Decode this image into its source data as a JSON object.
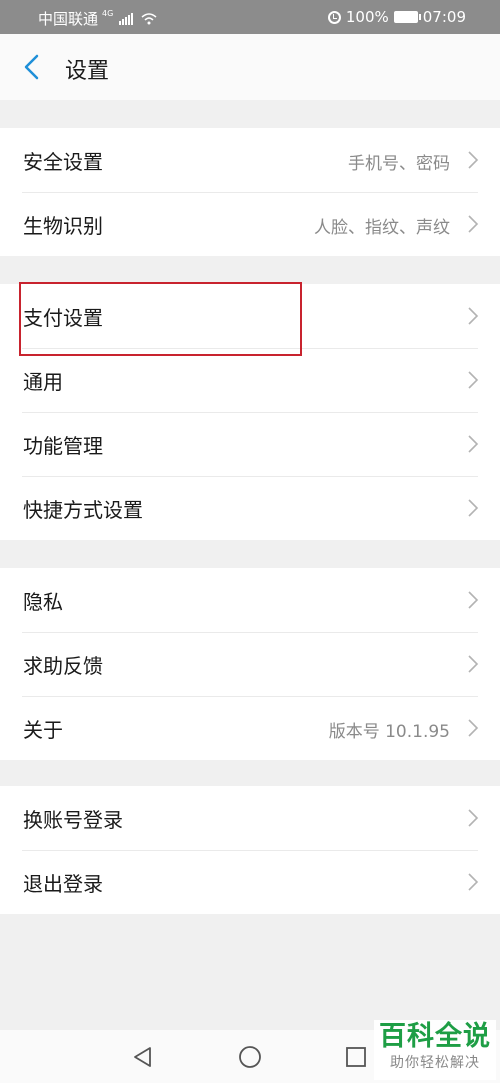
{
  "status_bar": {
    "carrier": "中国联通",
    "network": "4G",
    "battery": "100%",
    "time": "07:09"
  },
  "header": {
    "title": "设置"
  },
  "groups": [
    {
      "items": [
        {
          "label": "安全设置",
          "value": "手机号、密码"
        },
        {
          "label": "生物识别",
          "value": "人脸、指纹、声纹"
        }
      ]
    },
    {
      "items": [
        {
          "label": "支付设置",
          "value": ""
        },
        {
          "label": "通用",
          "value": ""
        },
        {
          "label": "功能管理",
          "value": ""
        },
        {
          "label": "快捷方式设置",
          "value": ""
        }
      ]
    },
    {
      "items": [
        {
          "label": "隐私",
          "value": ""
        },
        {
          "label": "求助反馈",
          "value": ""
        },
        {
          "label": "关于",
          "value": "版本号 10.1.95"
        }
      ]
    },
    {
      "items": [
        {
          "label": "换账号登录",
          "value": ""
        },
        {
          "label": "退出登录",
          "value": ""
        }
      ]
    }
  ],
  "highlighted_item": "支付设置",
  "watermark": {
    "title": "百科全说",
    "subtitle": "助你轻松解决"
  },
  "colors": {
    "accent": "#1e8fd8",
    "highlight_box": "#c8232e",
    "watermark_green": "#1e9e45"
  }
}
